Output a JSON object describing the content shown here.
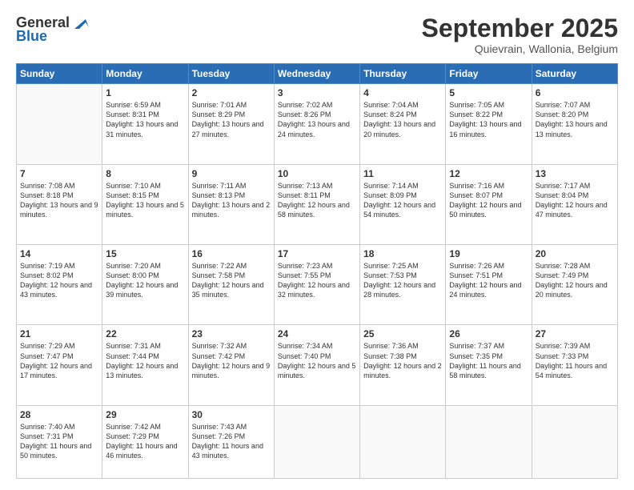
{
  "header": {
    "logo": {
      "general": "General",
      "blue": "Blue"
    },
    "title": "September 2025",
    "subtitle": "Quievrain, Wallonia, Belgium"
  },
  "weekdays": [
    "Sunday",
    "Monday",
    "Tuesday",
    "Wednesday",
    "Thursday",
    "Friday",
    "Saturday"
  ],
  "weeks": [
    [
      {
        "day": "",
        "sunrise": "",
        "sunset": "",
        "daylight": ""
      },
      {
        "day": "1",
        "sunrise": "Sunrise: 6:59 AM",
        "sunset": "Sunset: 8:31 PM",
        "daylight": "Daylight: 13 hours and 31 minutes."
      },
      {
        "day": "2",
        "sunrise": "Sunrise: 7:01 AM",
        "sunset": "Sunset: 8:29 PM",
        "daylight": "Daylight: 13 hours and 27 minutes."
      },
      {
        "day": "3",
        "sunrise": "Sunrise: 7:02 AM",
        "sunset": "Sunset: 8:26 PM",
        "daylight": "Daylight: 13 hours and 24 minutes."
      },
      {
        "day": "4",
        "sunrise": "Sunrise: 7:04 AM",
        "sunset": "Sunset: 8:24 PM",
        "daylight": "Daylight: 13 hours and 20 minutes."
      },
      {
        "day": "5",
        "sunrise": "Sunrise: 7:05 AM",
        "sunset": "Sunset: 8:22 PM",
        "daylight": "Daylight: 13 hours and 16 minutes."
      },
      {
        "day": "6",
        "sunrise": "Sunrise: 7:07 AM",
        "sunset": "Sunset: 8:20 PM",
        "daylight": "Daylight: 13 hours and 13 minutes."
      }
    ],
    [
      {
        "day": "7",
        "sunrise": "Sunrise: 7:08 AM",
        "sunset": "Sunset: 8:18 PM",
        "daylight": "Daylight: 13 hours and 9 minutes."
      },
      {
        "day": "8",
        "sunrise": "Sunrise: 7:10 AM",
        "sunset": "Sunset: 8:15 PM",
        "daylight": "Daylight: 13 hours and 5 minutes."
      },
      {
        "day": "9",
        "sunrise": "Sunrise: 7:11 AM",
        "sunset": "Sunset: 8:13 PM",
        "daylight": "Daylight: 13 hours and 2 minutes."
      },
      {
        "day": "10",
        "sunrise": "Sunrise: 7:13 AM",
        "sunset": "Sunset: 8:11 PM",
        "daylight": "Daylight: 12 hours and 58 minutes."
      },
      {
        "day": "11",
        "sunrise": "Sunrise: 7:14 AM",
        "sunset": "Sunset: 8:09 PM",
        "daylight": "Daylight: 12 hours and 54 minutes."
      },
      {
        "day": "12",
        "sunrise": "Sunrise: 7:16 AM",
        "sunset": "Sunset: 8:07 PM",
        "daylight": "Daylight: 12 hours and 50 minutes."
      },
      {
        "day": "13",
        "sunrise": "Sunrise: 7:17 AM",
        "sunset": "Sunset: 8:04 PM",
        "daylight": "Daylight: 12 hours and 47 minutes."
      }
    ],
    [
      {
        "day": "14",
        "sunrise": "Sunrise: 7:19 AM",
        "sunset": "Sunset: 8:02 PM",
        "daylight": "Daylight: 12 hours and 43 minutes."
      },
      {
        "day": "15",
        "sunrise": "Sunrise: 7:20 AM",
        "sunset": "Sunset: 8:00 PM",
        "daylight": "Daylight: 12 hours and 39 minutes."
      },
      {
        "day": "16",
        "sunrise": "Sunrise: 7:22 AM",
        "sunset": "Sunset: 7:58 PM",
        "daylight": "Daylight: 12 hours and 35 minutes."
      },
      {
        "day": "17",
        "sunrise": "Sunrise: 7:23 AM",
        "sunset": "Sunset: 7:55 PM",
        "daylight": "Daylight: 12 hours and 32 minutes."
      },
      {
        "day": "18",
        "sunrise": "Sunrise: 7:25 AM",
        "sunset": "Sunset: 7:53 PM",
        "daylight": "Daylight: 12 hours and 28 minutes."
      },
      {
        "day": "19",
        "sunrise": "Sunrise: 7:26 AM",
        "sunset": "Sunset: 7:51 PM",
        "daylight": "Daylight: 12 hours and 24 minutes."
      },
      {
        "day": "20",
        "sunrise": "Sunrise: 7:28 AM",
        "sunset": "Sunset: 7:49 PM",
        "daylight": "Daylight: 12 hours and 20 minutes."
      }
    ],
    [
      {
        "day": "21",
        "sunrise": "Sunrise: 7:29 AM",
        "sunset": "Sunset: 7:47 PM",
        "daylight": "Daylight: 12 hours and 17 minutes."
      },
      {
        "day": "22",
        "sunrise": "Sunrise: 7:31 AM",
        "sunset": "Sunset: 7:44 PM",
        "daylight": "Daylight: 12 hours and 13 minutes."
      },
      {
        "day": "23",
        "sunrise": "Sunrise: 7:32 AM",
        "sunset": "Sunset: 7:42 PM",
        "daylight": "Daylight: 12 hours and 9 minutes."
      },
      {
        "day": "24",
        "sunrise": "Sunrise: 7:34 AM",
        "sunset": "Sunset: 7:40 PM",
        "daylight": "Daylight: 12 hours and 5 minutes."
      },
      {
        "day": "25",
        "sunrise": "Sunrise: 7:36 AM",
        "sunset": "Sunset: 7:38 PM",
        "daylight": "Daylight: 12 hours and 2 minutes."
      },
      {
        "day": "26",
        "sunrise": "Sunrise: 7:37 AM",
        "sunset": "Sunset: 7:35 PM",
        "daylight": "Daylight: 11 hours and 58 minutes."
      },
      {
        "day": "27",
        "sunrise": "Sunrise: 7:39 AM",
        "sunset": "Sunset: 7:33 PM",
        "daylight": "Daylight: 11 hours and 54 minutes."
      }
    ],
    [
      {
        "day": "28",
        "sunrise": "Sunrise: 7:40 AM",
        "sunset": "Sunset: 7:31 PM",
        "daylight": "Daylight: 11 hours and 50 minutes."
      },
      {
        "day": "29",
        "sunrise": "Sunrise: 7:42 AM",
        "sunset": "Sunset: 7:29 PM",
        "daylight": "Daylight: 11 hours and 46 minutes."
      },
      {
        "day": "30",
        "sunrise": "Sunrise: 7:43 AM",
        "sunset": "Sunset: 7:26 PM",
        "daylight": "Daylight: 11 hours and 43 minutes."
      },
      {
        "day": "",
        "sunrise": "",
        "sunset": "",
        "daylight": ""
      },
      {
        "day": "",
        "sunrise": "",
        "sunset": "",
        "daylight": ""
      },
      {
        "day": "",
        "sunrise": "",
        "sunset": "",
        "daylight": ""
      },
      {
        "day": "",
        "sunrise": "",
        "sunset": "",
        "daylight": ""
      }
    ]
  ]
}
